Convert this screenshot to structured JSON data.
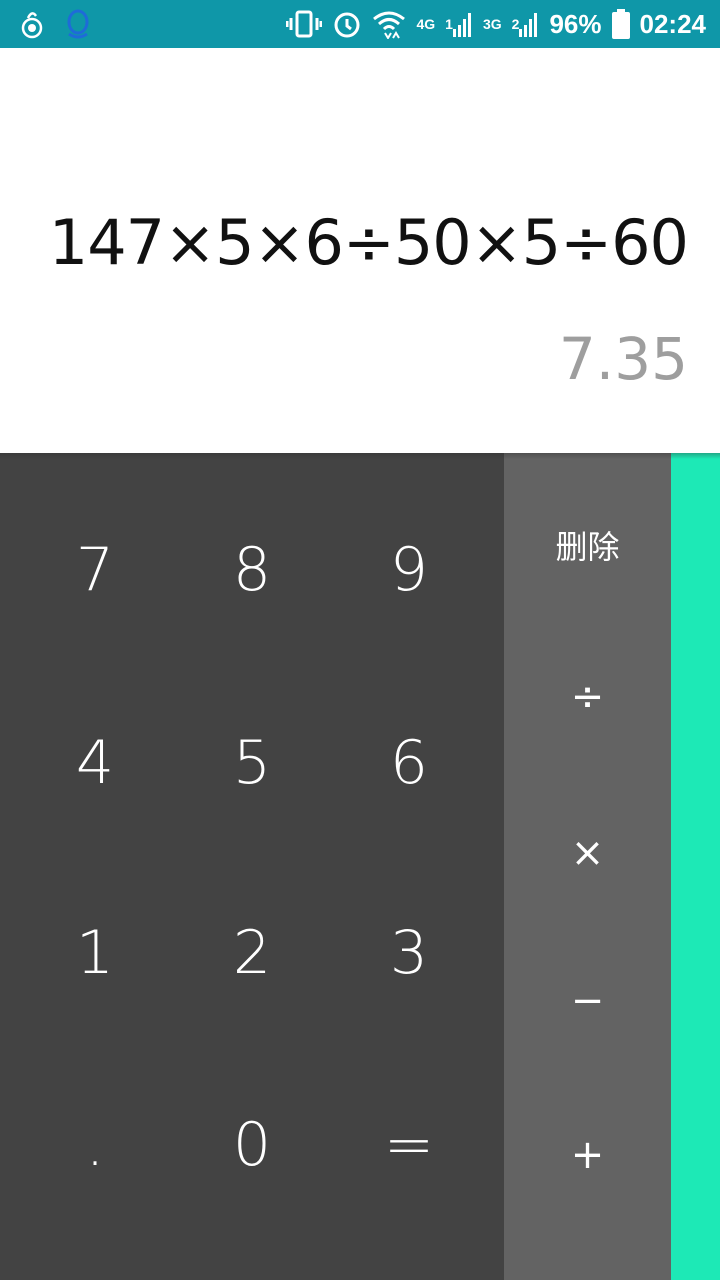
{
  "status_bar": {
    "battery": "96%",
    "time": "02:24",
    "net_4g": "4G",
    "net_3g": "3G",
    "sim1": "1",
    "sim2": "2"
  },
  "display": {
    "formula": "147×5×6÷50×5÷60",
    "result": "7.35"
  },
  "keypad": {
    "digits": [
      "7",
      "8",
      "9",
      "4",
      "5",
      "6",
      "1",
      "2",
      "3",
      ".",
      "0",
      "="
    ],
    "operators": {
      "delete": "删除",
      "divide": "÷",
      "multiply": "×",
      "subtract": "−",
      "add": "+"
    }
  },
  "colors": {
    "status_bar": "#0f97a8",
    "pad_numbers": "#434343",
    "pad_operators": "#636363",
    "pad_advanced": "#1de9b6",
    "result_text": "#9e9e9e"
  }
}
